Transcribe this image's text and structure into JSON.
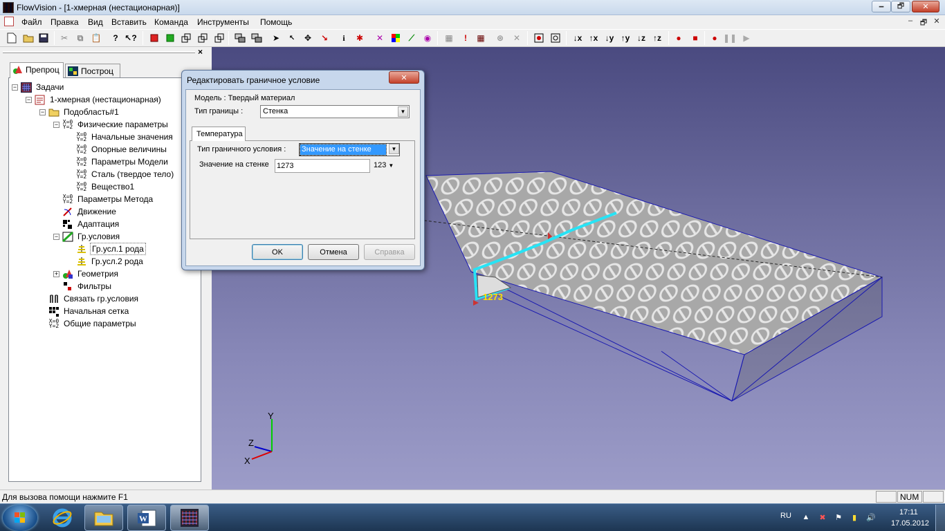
{
  "window": {
    "title": "FlowVision - [1-хмерная (нестационарная)]",
    "minimize": "🗕",
    "maximize": "🗗",
    "close": "✕"
  },
  "menu": {
    "items": [
      "Файл",
      "Правка",
      "Вид",
      "Вставить",
      "Команда",
      "Инструменты",
      "Помощь"
    ],
    "mdi": {
      "minimize": "–",
      "restore": "🗗",
      "close": "✕"
    }
  },
  "toolbar": {
    "icons": [
      "new-icon",
      "open-icon",
      "save-icon",
      "cut-icon",
      "copy-icon",
      "paste-icon",
      "help-icon",
      "context-help-icon",
      "cube-red-icon",
      "cube-green-icon",
      "layers-icon",
      "layers2-icon",
      "layers3-icon",
      "select-icon",
      "pointer-icon",
      "pointer2-icon",
      "move-icon",
      "probe-icon",
      "info-icon",
      "bug-icon",
      "color-icon",
      "rgb-icon",
      "graph-icon",
      "sound-icon",
      "grid-icon",
      "exclaim-icon",
      "grid2-icon",
      "record-icon",
      "cross-icon",
      "camera-icon",
      "camera2-icon",
      "axis-down-x",
      "axis-up-x",
      "axis-down-y",
      "axis-up-y",
      "axis-down-z",
      "axis-up-z",
      "run-icon",
      "stop-icon",
      "record-dot-icon",
      "pause-icon",
      "play-icon"
    ],
    "axis_labels": {
      "down_x": "↓x",
      "up_x": "↑x",
      "down_y": "↓y",
      "up_y": "↑y",
      "down_z": "↓z",
      "up_z": "↑z"
    }
  },
  "panel": {
    "close": "×",
    "tabs": [
      {
        "label": "Препроц"
      },
      {
        "label": "Построц"
      }
    ],
    "tree": {
      "root": "Задачи",
      "project": "1-хмерная (нестационарная)",
      "subdomain": "Подобласть#1",
      "physical": "Физические параметры",
      "initial": "Начальные значения",
      "reference": "Опорные величины",
      "model_params": "Параметры Модели",
      "steel": "Сталь (твердое тело)",
      "substance": "Вещество1",
      "method_params": "Параметры Метода",
      "motion": "Движение",
      "adaptation": "Адаптация",
      "bc": "Гр.условия",
      "bc1": "Гр.усл.1 рода",
      "bc2": "Гр.усл.2 рода",
      "geometry": "Геометрия",
      "filters": "Фильтры",
      "link_bc": "Связать гр.условия",
      "initial_grid": "Начальная сетка",
      "general_params": "Общие параметры"
    }
  },
  "viewport": {
    "label_bc": "1273",
    "axis": {
      "y": "Y",
      "z": "Z",
      "x": "X"
    }
  },
  "dialog": {
    "title": "Редактировать граничное условие",
    "close": "✕",
    "model": "Модель : Твердый материал",
    "boundary_type_label": "Тип границы :",
    "boundary_type_value": "Стенка",
    "tab": "Температура",
    "bc_type_label": "Тип граничного условия :",
    "bc_type_value": "Значение на стенке",
    "wall_value_label": "Значение на стенке",
    "wall_value": "1273",
    "unit": "123",
    "ok": "OK",
    "cancel": "Отмена",
    "help": "Справка"
  },
  "status": {
    "text": "Для вызова помощи нажмите F1",
    "num": "NUM"
  },
  "taskbar": {
    "lang": "RU",
    "time": "17:11",
    "date": "17.05.2012"
  },
  "colors": {
    "accent": "#3399ff",
    "viewport_top": "#4a4a80",
    "viewport_bottom": "#9c9cc8",
    "highlight": "#27e3f5"
  }
}
